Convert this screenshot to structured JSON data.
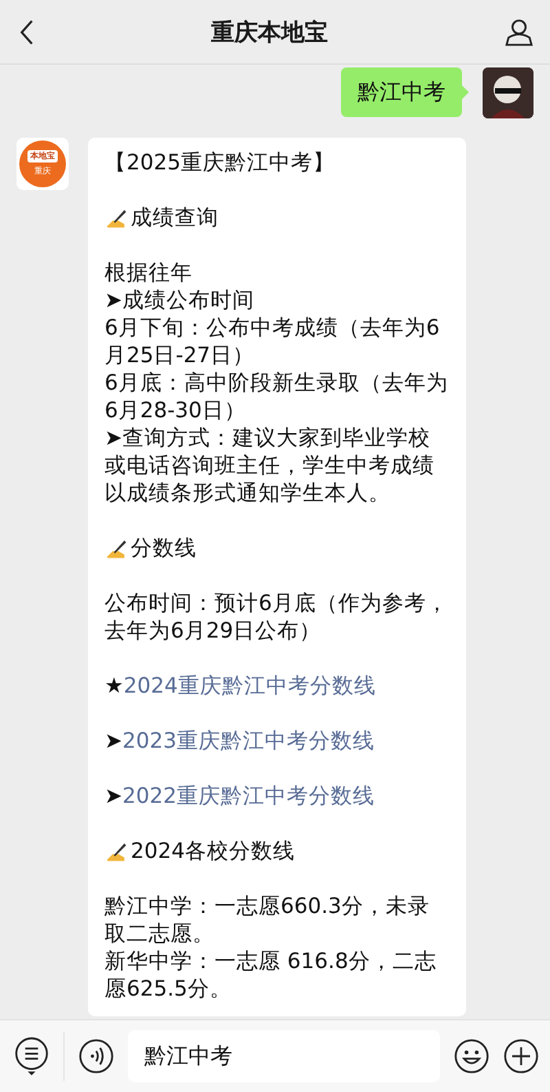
{
  "header": {
    "title": "重庆本地宝"
  },
  "my_message": {
    "text": "黔江中考"
  },
  "official_account": {
    "logo_top": "本地宝",
    "logo_bottom": "重庆"
  },
  "article_blocks": [
    [
      {
        "kind": "text",
        "text": "【2025重庆黔江中考】"
      }
    ],
    [
      {
        "kind": "heading",
        "text": "成绩查询"
      }
    ],
    [
      {
        "kind": "text",
        "text": "根据往年"
      },
      {
        "kind": "text",
        "text": "➤成绩公布时间"
      },
      {
        "kind": "text",
        "text": "6月下旬：公布中考成绩（去年为6月25日-27日）"
      },
      {
        "kind": "text",
        "text": "6月底：高中阶段新生录取（去年为6月28-30日）"
      },
      {
        "kind": "text",
        "text": "➤查询方式：建议大家到毕业学校或电话咨询班主任，学生中考成绩以成绩条形式通知学生本人。"
      }
    ],
    [
      {
        "kind": "heading",
        "text": "分数线"
      }
    ],
    [
      {
        "kind": "text",
        "text": "公布时间：预计6月底（作为参考，去年为6月29日公布）"
      }
    ],
    [
      {
        "kind": "link",
        "marker": "★",
        "text": "2024重庆黔江中考分数线"
      }
    ],
    [
      {
        "kind": "link",
        "marker": "➤",
        "text": "2023重庆黔江中考分数线"
      }
    ],
    [
      {
        "kind": "link",
        "marker": "➤",
        "text": "2022重庆黔江中考分数线"
      }
    ],
    [
      {
        "kind": "heading",
        "text": "2024各校分数线"
      }
    ],
    [
      {
        "kind": "text",
        "text": "黔江中学：一志愿660.3分，未录取二志愿。"
      },
      {
        "kind": "text",
        "text": "新华中学：一志愿 616.8分，二志愿625.5分。"
      }
    ]
  ],
  "input_bar": {
    "value": "黔江中考"
  }
}
